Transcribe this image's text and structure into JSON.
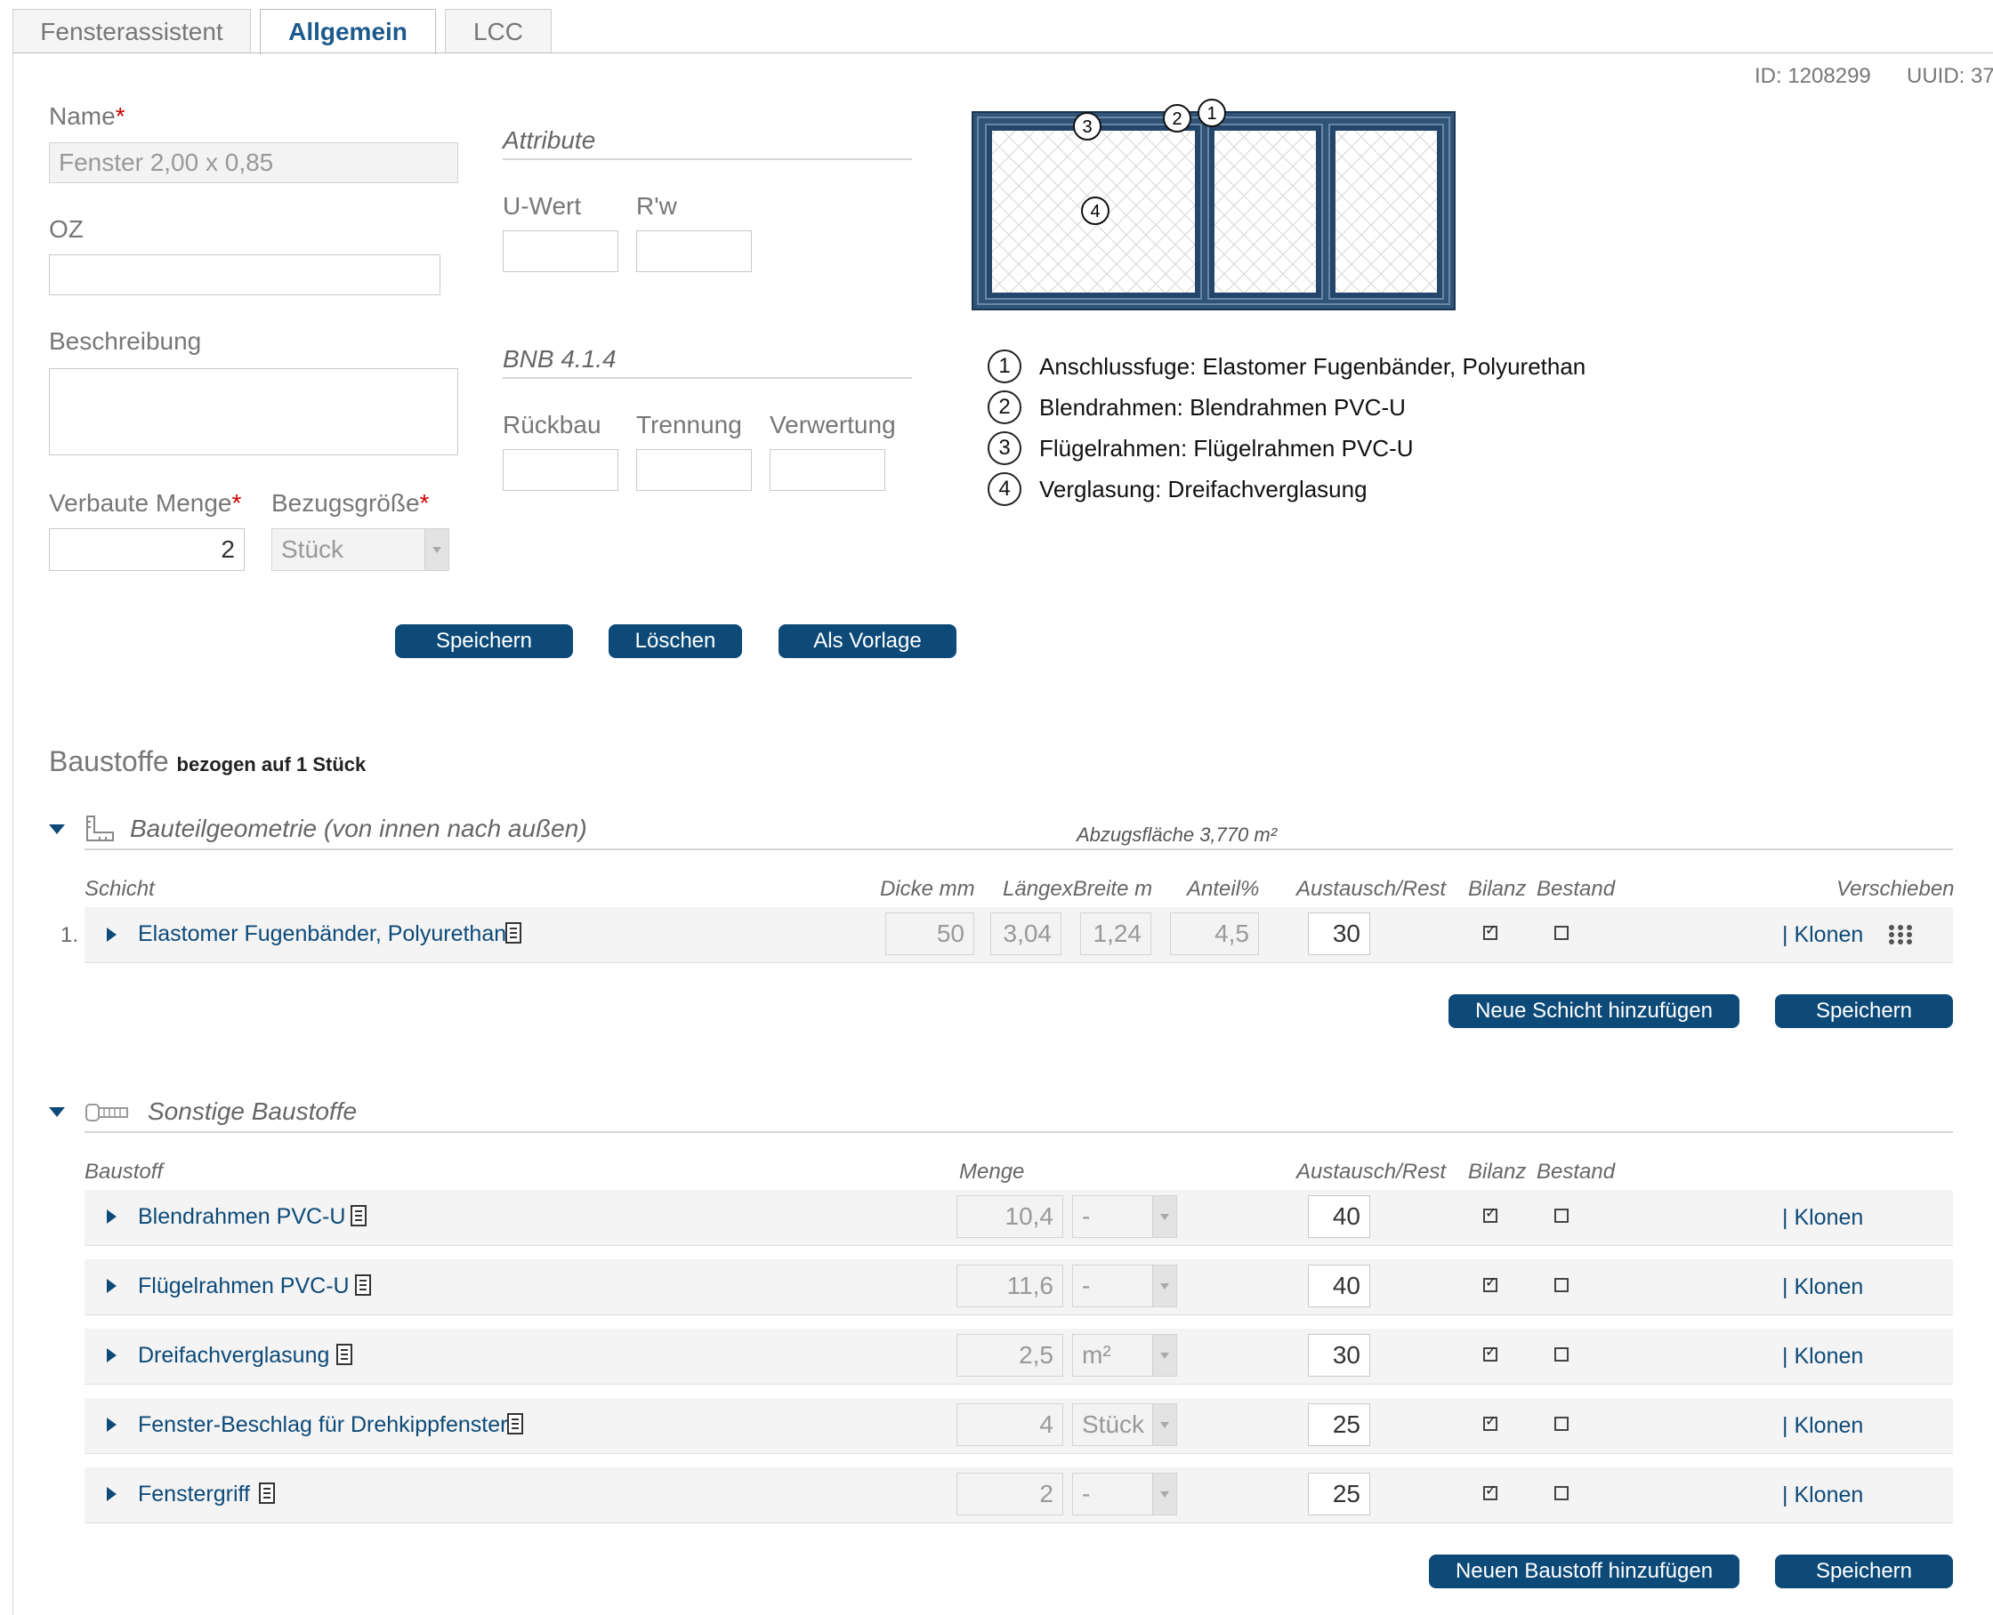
{
  "tabs": [
    {
      "label": "Fensterassistent"
    },
    {
      "label": "Allgemein",
      "active": true
    },
    {
      "label": "LCC"
    }
  ],
  "meta": {
    "id": "ID: 1208299",
    "uuid": "UUID: 37"
  },
  "form": {
    "name_label": "Name",
    "name_value": "Fenster 2,00 x 0,85",
    "oz_label": "OZ",
    "oz_value": "",
    "beschreibung_label": "Beschreibung",
    "beschreibung_value": "",
    "menge_label": "Verbaute Menge",
    "menge_value": "2",
    "bezug_label": "Bezugsgröße",
    "bezug_value": "Stück",
    "required_mark": "*"
  },
  "attribute": {
    "title": "Attribute",
    "uwert_label": "U-Wert",
    "uwert_value": "",
    "rw_label": "R'w",
    "rw_value": ""
  },
  "bnb": {
    "title": "BNB 4.1.4",
    "rueckbau_label": "Rückbau",
    "trennung_label": "Trennung",
    "verwertung_label": "Verwertung"
  },
  "buttons": {
    "save": "Speichern",
    "delete": "Löschen",
    "template": "Als Vorlage"
  },
  "legend": [
    {
      "num": "1",
      "text": "Anschlussfuge: Elastomer Fugenbänder, Polyurethan"
    },
    {
      "num": "2",
      "text": "Blendrahmen: Blendrahmen PVC-U"
    },
    {
      "num": "3",
      "text": "Flügelrahmen: Flügelrahmen PVC-U"
    },
    {
      "num": "4",
      "text": "Verglasung: Dreifachverglasung"
    }
  ],
  "baustoffe": {
    "title": "Baustoffe",
    "subtitle": "bezogen auf 1 Stück"
  },
  "geometrie": {
    "title": "Bauteilgeometrie (von innen nach außen)",
    "abzug": "Abzugsfläche 3,770 m²",
    "headers": {
      "schicht": "Schicht",
      "dicke": "Dicke mm",
      "laenge": "LängexBreite m",
      "anteil": "Anteil%",
      "austausch": "Austausch/Rest",
      "bilanz": "Bilanz",
      "bestand": "Bestand",
      "verschieben": "Verschieben"
    },
    "rows": [
      {
        "index": "1.",
        "name": "Elastomer Fugenbänder, Polyurethan",
        "dicke": "50",
        "laenge": "3,04",
        "breite": "1,24",
        "anteil": "4,5",
        "austausch": "30",
        "bilanz": true,
        "bestand": false,
        "klonen": "| Klonen"
      }
    ],
    "add_button": "Neue Schicht hinzufügen",
    "save_button": "Speichern"
  },
  "sonstige": {
    "title": "Sonstige Baustoffe",
    "headers": {
      "baustoff": "Baustoff",
      "menge": "Menge",
      "austausch": "Austausch/Rest",
      "bilanz": "Bilanz",
      "bestand": "Bestand"
    },
    "rows": [
      {
        "name": "Blendrahmen PVC-U",
        "menge": "10,4",
        "unit": "-",
        "austausch": "40",
        "bilanz": true,
        "bestand": false,
        "klonen": "| Klonen"
      },
      {
        "name": "Flügelrahmen PVC-U",
        "menge": "11,6",
        "unit": "-",
        "austausch": "40",
        "bilanz": true,
        "bestand": false,
        "klonen": "| Klonen"
      },
      {
        "name": "Dreifachverglasung",
        "menge": "2,5",
        "unit": "m²",
        "austausch": "30",
        "bilanz": true,
        "bestand": false,
        "klonen": "| Klonen"
      },
      {
        "name": "Fenster-Beschlag für Drehkippfenster",
        "menge": "4",
        "unit": "Stück",
        "austausch": "25",
        "bilanz": true,
        "bestand": false,
        "klonen": "| Klonen"
      },
      {
        "name": "Fenstergriff",
        "menge": "2",
        "unit": "-",
        "austausch": "25",
        "bilanz": true,
        "bestand": false,
        "klonen": "| Klonen"
      }
    ],
    "add_button": "Neuen Baustoff hinzufügen",
    "save_button": "Speichern"
  },
  "colors": {
    "accent": "#0d4a78",
    "frame": "#2f5478",
    "required": "#cc0000"
  }
}
